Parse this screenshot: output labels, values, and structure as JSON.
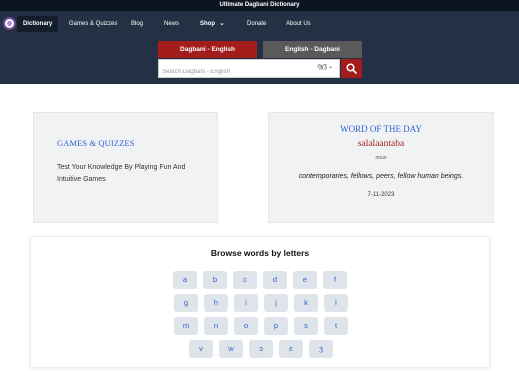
{
  "header": {
    "site_title": "Ultimate Dagbani Dictionary"
  },
  "nav": {
    "items": [
      {
        "label": "Dictionary"
      },
      {
        "label": "Games & Quizzes"
      },
      {
        "label": "Blog"
      },
      {
        "label": "News"
      },
      {
        "label": "Shop"
      },
      {
        "label": "Donate"
      },
      {
        "label": "About Us"
      }
    ]
  },
  "search": {
    "direction_buttons": [
      "Dagbani - English",
      "English - Dagbani"
    ],
    "placeholder": "Search Dagbani - English",
    "keyboard_label": "ŋɣʒ"
  },
  "games_card": {
    "title": "GAMES & QUIZZES",
    "description": "Test Your Knowledge By Playing Fun And Intuitive Games"
  },
  "word_of_day": {
    "title": "WORD OF THE DAY",
    "word": "salalaantaba",
    "part_of_speech": "noun",
    "definition": "contemporaries, fellows, peers, fellow human beings.",
    "date": "7-11-2023"
  },
  "browse": {
    "title": "Browse words by letters",
    "letters": [
      "a",
      "b",
      "c",
      "d",
      "e",
      "f",
      "g",
      "h",
      "i",
      "j",
      "k",
      "l",
      "m",
      "n",
      "o",
      "p",
      "s",
      "t",
      "v",
      "w",
      "ɔ",
      "ɛ",
      "ʒ"
    ]
  },
  "colors": {
    "accent_red": "#a41d1d",
    "accent_blue": "#2c63d3",
    "nav_bg": "#243043"
  }
}
